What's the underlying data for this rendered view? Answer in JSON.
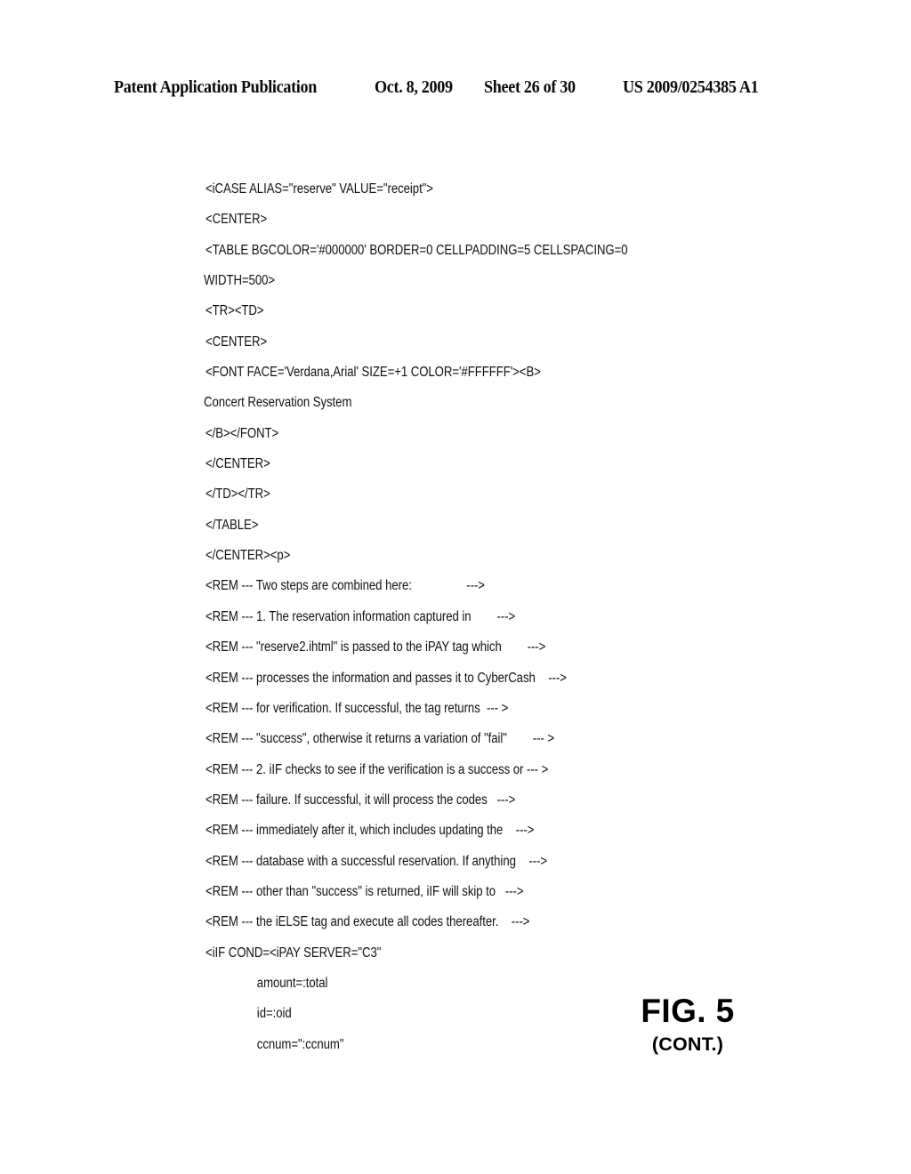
{
  "header": {
    "publication_type": "Patent Application Publication",
    "date": "Oct. 8, 2009",
    "sheet": "Sheet 26 of 30",
    "publication_number": "US 2009/0254385 A1"
  },
  "figure": {
    "label": "FIG. 5",
    "continuation": "(CONT.)"
  },
  "code_listing": {
    "lines": [
      "<iCASE ALIAS=\"reserve\" VALUE=\"receipt\">",
      "<CENTER>",
      "<TABLE BGCOLOR='#000000' BORDER=0 CELLPADDING=5 CELLSPACING=0",
      "WIDTH=500>",
      "<TR><TD>",
      "<CENTER>",
      "<FONT FACE='Verdana,Arial' SIZE=+1 COLOR='#FFFFFF'><B>",
      "Concert Reservation System",
      "</B></FONT>",
      "</CENTER>",
      "</TD></TR>",
      "</TABLE>",
      "</CENTER><p>",
      "<REM --- Two steps are combined here:                 --->",
      "<REM --- 1. The reservation information captured in        --->",
      "<REM --- \"reserve2.ihtml\" is passed to the iPAY tag which        --->",
      "<REM --- processes the information and passes it to CyberCash    --->",
      "<REM --- for verification. If successful, the tag returns  --- >",
      "<REM --- \"success\", otherwise it returns a variation of \"fail\"        --- >",
      "<REM --- 2. iIF checks to see if the verification is a success or --- >",
      "<REM --- failure. If successful, it will process the codes   --->",
      "<REM --- immediately after it, which includes updating the    --->",
      "<REM --- database with a successful reservation. If anything    --->",
      "<REM --- other than \"success\" is returned, iIF will skip to   --->",
      "<REM --- the iELSE tag and execute all codes thereafter.    --->",
      "<iIF COND=<iPAY SERVER=\"C3\"",
      "                amount=:total",
      "                id=:oid",
      "                ccnum=\":ccnum\""
    ],
    "wrapped_line_indices": [
      3,
      7
    ]
  }
}
